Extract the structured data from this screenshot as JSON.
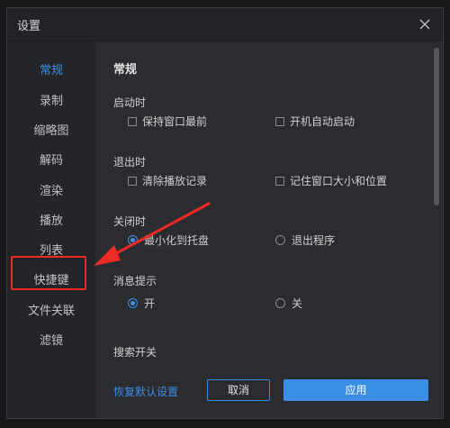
{
  "window": {
    "title": "设置"
  },
  "sidebar": {
    "items": [
      {
        "label": "常规"
      },
      {
        "label": "录制"
      },
      {
        "label": "缩略图"
      },
      {
        "label": "解码"
      },
      {
        "label": "渲染"
      },
      {
        "label": "播放"
      },
      {
        "label": "列表"
      },
      {
        "label": "快捷键"
      },
      {
        "label": "文件关联"
      },
      {
        "label": "滤镜"
      }
    ],
    "active_index": 0,
    "highlighted_index": 7
  },
  "content": {
    "section_title": "常规",
    "startup": {
      "label": "启动时",
      "options": [
        {
          "label": "保持窗口最前",
          "checked": false
        },
        {
          "label": "开机自动启动",
          "checked": false
        }
      ]
    },
    "exit": {
      "label": "退出时",
      "options": [
        {
          "label": "清除播放记录",
          "checked": false
        },
        {
          "label": "记住窗口大小和位置",
          "checked": false
        }
      ]
    },
    "close": {
      "label": "关闭时",
      "options": [
        {
          "label": "最小化到托盘",
          "selected": true
        },
        {
          "label": "退出程序",
          "selected": false
        }
      ]
    },
    "notify": {
      "label": "消息提示",
      "options": [
        {
          "label": "开",
          "selected": true
        },
        {
          "label": "关",
          "selected": false
        }
      ]
    },
    "search": {
      "label": "搜索开关"
    }
  },
  "footer": {
    "reset_label": "恢复默认设置",
    "cancel_label": "取消",
    "apply_label": "应用"
  },
  "colors": {
    "accent": "#3a8ee6",
    "annotation": "#ee2a24"
  }
}
